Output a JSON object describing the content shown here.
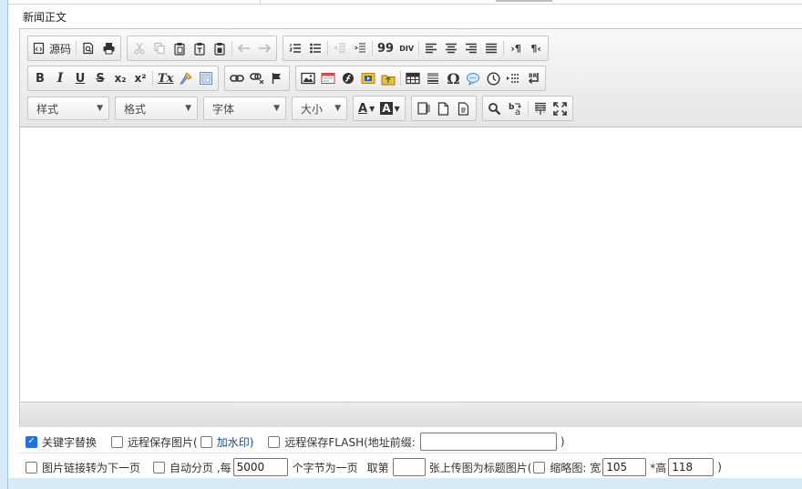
{
  "field_label": "新闻正文",
  "toolbar": {
    "source_label": "源码",
    "style_combo": "样式",
    "format_combo": "格式",
    "font_combo": "字体",
    "size_combo": "大小",
    "icons": {
      "bold": "B",
      "italic": "I",
      "underline": "U",
      "strike": "S",
      "subscript": "x₂",
      "superscript": "x²",
      "remove_format": "Tx",
      "blockquote": "99",
      "div": "DIV",
      "omega": "Ω",
      "text_color": "A",
      "bg_color": "A"
    }
  },
  "options": {
    "keyword_replace": {
      "label": "关键字替换",
      "checked": true
    },
    "remote_save_image": {
      "label": "远程保存图片(",
      "checked": false
    },
    "watermark": {
      "label": "加水印)",
      "checked": false
    },
    "remote_save_flash": {
      "label": "远程保存FLASH(地址前缀:",
      "checked": false,
      "value": "",
      "close": ")"
    },
    "image_link_next": {
      "label": "图片链接转为下一页",
      "checked": false
    },
    "auto_paging": {
      "label": "自动分页 ,每",
      "checked": false,
      "value": "5000",
      "suffix": "个字节为一页"
    },
    "take_nth": {
      "prefix": "取第",
      "value": "",
      "suffix": "张上传图为标题图片("
    },
    "thumbnail": {
      "label": "缩略图: 宽",
      "checked": false,
      "width": "105",
      "height_label": "*高",
      "height": "118",
      "close": ")"
    }
  },
  "colors": {
    "accent_checkbox": "#1a73e8",
    "page_bg": "#d6ebf7"
  }
}
